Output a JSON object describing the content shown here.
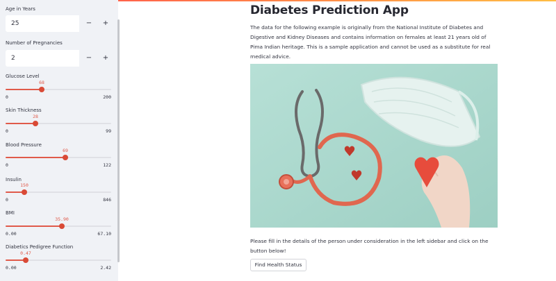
{
  "app": {
    "title": "Diabetes Prediction App"
  },
  "sidebar": {
    "age": {
      "label": "Age in Years",
      "value": "25",
      "minus": "−",
      "plus": "+"
    },
    "pregnancies": {
      "label": "Number of Pregnancies",
      "value": "2",
      "minus": "−",
      "plus": "+"
    },
    "sliders": [
      {
        "label": "Glucose Level",
        "value": "68",
        "min": "0",
        "max": "200",
        "fraction": 0.34
      },
      {
        "label": "Skin Thickness",
        "value": "28",
        "min": "0",
        "max": "99",
        "fraction": 0.283
      },
      {
        "label": "Blood Pressure",
        "value": "69",
        "min": "0",
        "max": "122",
        "fraction": 0.566
      },
      {
        "label": "Insulin",
        "value": "150",
        "min": "0",
        "max": "846",
        "fraction": 0.177
      },
      {
        "label": "BMI",
        "value": "35.90",
        "min": "0.00",
        "max": "67.10",
        "fraction": 0.535
      },
      {
        "label": "Diabetics Pedigree Function",
        "value": "0.47",
        "min": "0.00",
        "max": "2.42",
        "fraction": 0.194
      }
    ]
  },
  "main": {
    "description": "The data for the following example is originally from the National Institute of Diabetes and Digestive and Kidney Diseases and contains information on females at least 21 years old of Pima Indian heritage. This is a sample application and cannot be used as a substitute for real medical advice.",
    "instructions": "Please fill in the details of the person under consideration in the left sidebar and click on the button below!",
    "button_label": "Find Health Status"
  },
  "colors": {
    "accent": "#e05a4a",
    "sidebar_bg": "#f0f2f6",
    "photo_bg": "#a9d8cc"
  }
}
